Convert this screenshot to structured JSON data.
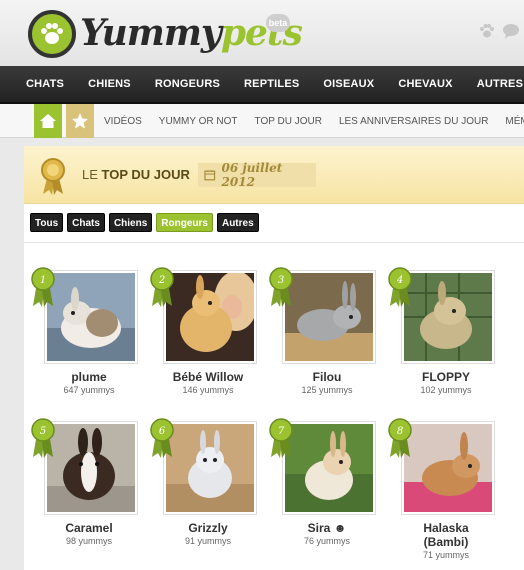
{
  "header": {
    "logo_part1": "Yummy",
    "logo_part2": "pets",
    "beta": "beta"
  },
  "categories": [
    "CHATS",
    "CHIENS",
    "RONGEURS",
    "REPTILES",
    "OISEAUX",
    "CHEVAUX",
    "AUTRES"
  ],
  "subnav": [
    "VIDÉOS",
    "YUMMY OR NOT",
    "TOP DU JOUR",
    "LES ANNIVERSAIRES DU JOUR",
    "MÉM"
  ],
  "banner": {
    "title_prefix": "LE",
    "title_bold": "TOP DU JOUR",
    "date": "06 juillet 2012"
  },
  "filters": [
    "Tous",
    "Chats",
    "Chiens",
    "Rongeurs",
    "Autres"
  ],
  "active_filter": "Rongeurs",
  "pets": [
    {
      "rank": "1",
      "name": "plume",
      "yummys": "647 yummys"
    },
    {
      "rank": "2",
      "name": "Bébé Willow",
      "yummys": "146 yummys"
    },
    {
      "rank": "3",
      "name": "Filou",
      "yummys": "125 yummys"
    },
    {
      "rank": "4",
      "name": "FLOPPY",
      "yummys": "102 yummys"
    },
    {
      "rank": "5",
      "name": "Caramel",
      "yummys": "98 yummys"
    },
    {
      "rank": "6",
      "name": "Grizzly",
      "yummys": "91 yummys"
    },
    {
      "rank": "7",
      "name": "Sira ☻",
      "yummys": "76 yummys"
    },
    {
      "rank": "8",
      "name": "Halaska (Bambi)",
      "yummys": "71 yummys"
    }
  ],
  "colors": {
    "brand_green": "#9bc330",
    "nav_dark": "#222222",
    "banner_gold": "#f7e4a3"
  }
}
